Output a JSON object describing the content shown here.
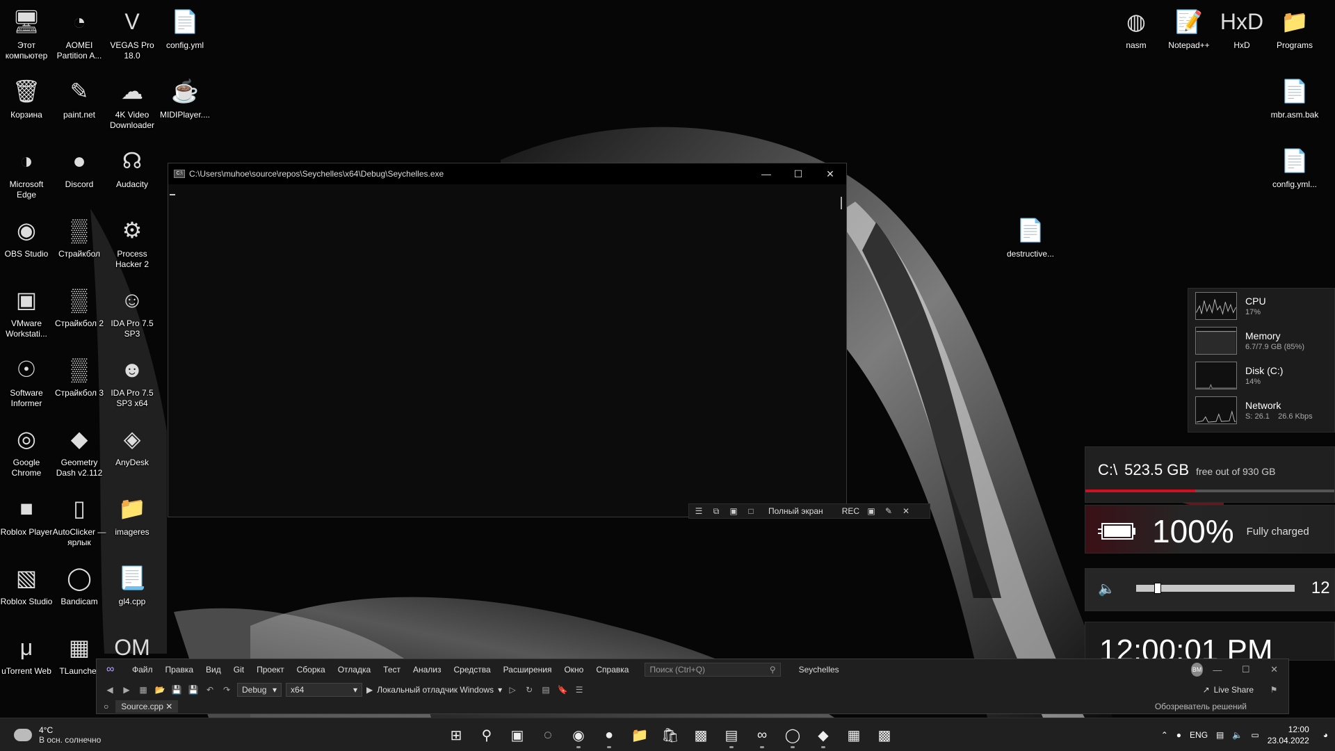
{
  "desktop": {
    "icons": [
      {
        "label": "Этот компьютер",
        "icon": "computer-icon"
      },
      {
        "label": "AOMEI Partition A...",
        "icon": "aomei-icon"
      },
      {
        "label": "VEGAS Pro 18.0",
        "icon": "vegas-icon"
      },
      {
        "label": "config.yml",
        "icon": "file-icon"
      },
      {
        "label": "Корзина",
        "icon": "recycle-bin-icon"
      },
      {
        "label": "paint.net",
        "icon": "paintnet-icon"
      },
      {
        "label": "4K Video Downloader",
        "icon": "video-downloader-icon"
      },
      {
        "label": "MIDIPlayer....",
        "icon": "java-icon"
      },
      {
        "label": "Microsoft Edge",
        "icon": "edge-icon"
      },
      {
        "label": "Discord",
        "icon": "discord-icon"
      },
      {
        "label": "Audacity",
        "icon": "audacity-icon"
      },
      {
        "label": "OBS Studio",
        "icon": "obs-icon"
      },
      {
        "label": "Страйкбол",
        "icon": "game-icon"
      },
      {
        "label": "Process Hacker 2",
        "icon": "process-hacker-icon"
      },
      {
        "label": "VMware Workstati...",
        "icon": "vmware-icon"
      },
      {
        "label": "Страйкбол 2",
        "icon": "game-icon"
      },
      {
        "label": "IDA Pro 7.5 SP3",
        "icon": "ida-icon"
      },
      {
        "label": "Software Informer",
        "icon": "software-informer-icon"
      },
      {
        "label": "Страйкбол 3",
        "icon": "game-icon"
      },
      {
        "label": "IDA Pro 7.5 SP3 x64",
        "icon": "ida64-icon"
      },
      {
        "label": "Google Chrome",
        "icon": "chrome-icon"
      },
      {
        "label": "Geometry Dash v2.112",
        "icon": "geometry-dash-icon"
      },
      {
        "label": "AnyDesk",
        "icon": "anydesk-icon"
      },
      {
        "label": "Roblox Player",
        "icon": "roblox-icon"
      },
      {
        "label": "AutoClicker — ярлык",
        "icon": "mouse-icon"
      },
      {
        "label": "imageres",
        "icon": "folder-icon"
      },
      {
        "label": "Roblox Studio",
        "icon": "roblox-studio-icon"
      },
      {
        "label": "Bandicam",
        "icon": "bandicam-icon"
      },
      {
        "label": "gl4.cpp",
        "icon": "cpp-file-icon"
      },
      {
        "label": "uTorrent Web",
        "icon": "utorrent-icon"
      },
      {
        "label": "TLauncher",
        "icon": "tlauncher-icon"
      },
      {
        "label": "OM",
        "icon": "om-icon"
      },
      {
        "label": "nasm",
        "icon": "nasm-icon"
      },
      {
        "label": "Notepad++",
        "icon": "notepadpp-icon"
      },
      {
        "label": "HxD",
        "icon": "hxd-icon"
      },
      {
        "label": "Programs",
        "icon": "folder-icon"
      },
      {
        "label": "mbr.asm.bak",
        "icon": "file-icon"
      },
      {
        "label": "config.yml...",
        "icon": "file-icon"
      },
      {
        "label": "destructive...",
        "icon": "file-icon"
      }
    ]
  },
  "console": {
    "title": "C:\\Users\\muhoe\\source\\repos\\Seychelles\\x64\\Debug\\Seychelles.exe",
    "app_icon": "C:\\"
  },
  "bandicam_bar": {
    "fullscreen_label": "Полный экран",
    "rec_label": "REC"
  },
  "perf_widget": {
    "cpu": {
      "name": "CPU",
      "value": "17%"
    },
    "memory": {
      "name": "Memory",
      "value": "6.7/7.9 GB (85%)"
    },
    "disk": {
      "name": "Disk (C:)",
      "value": "14%"
    },
    "network": {
      "name": "Network",
      "value": "S: 26.1",
      "value2": "26.6 Kbps"
    }
  },
  "disk_widget": {
    "drive": "C:\\",
    "size": "523.5 GB",
    "free_text": "free out of 930 GB",
    "used_fraction": 0.44
  },
  "battery_widget": {
    "percent": "100%",
    "status": "Fully charged"
  },
  "volume_widget": {
    "value": "12",
    "level": 0.12
  },
  "clock_widget": {
    "time": "12:00:01 PM"
  },
  "visual_studio": {
    "menu": [
      "Файл",
      "Правка",
      "Вид",
      "Git",
      "Проект",
      "Сборка",
      "Отладка",
      "Тест",
      "Анализ",
      "Средства",
      "Расширения",
      "Окно",
      "Справка"
    ],
    "search_placeholder": "Поиск (Ctrl+Q)",
    "project_name": "Seychelles",
    "avatar_initials": "BM",
    "config": "Debug",
    "platform": "x64",
    "debugger": "Локальный отладчик Windows",
    "live_share": "Live Share",
    "tab": "Source.cpp",
    "solution_explorer": "Обозреватель решений"
  },
  "taskbar": {
    "weather_temp": "4°C",
    "weather_desc": "В осн. солнечно",
    "language": "ENG",
    "time": "12:00",
    "date": "23.04.2022"
  },
  "colors": {
    "accent_red": "#d01020",
    "vs_purple": "#bba6ff"
  }
}
